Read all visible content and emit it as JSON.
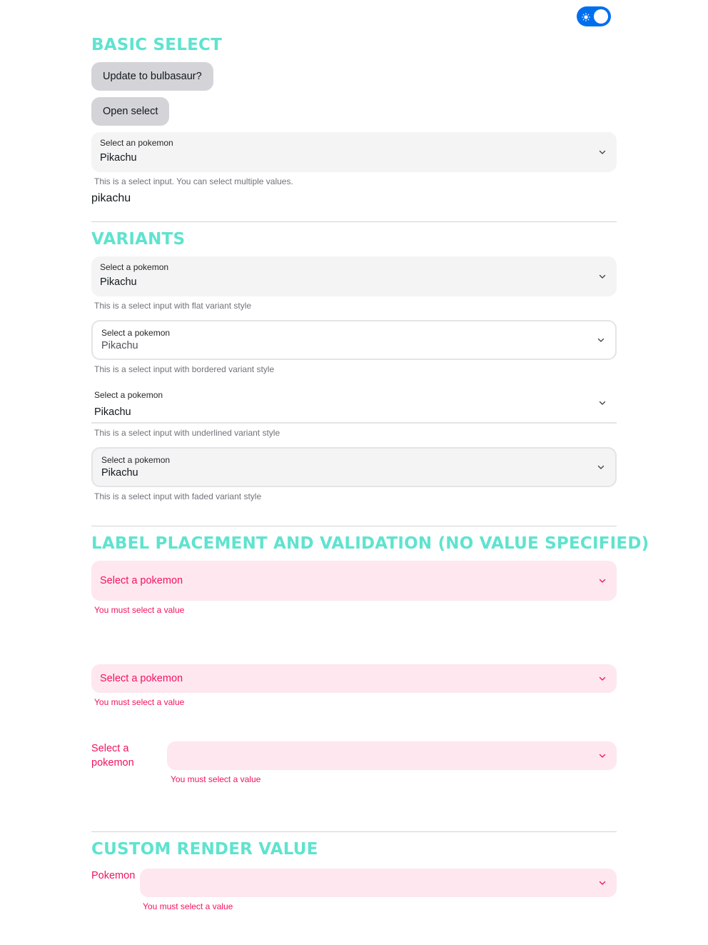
{
  "theme_toggle": {
    "state": "on",
    "icon": "sun-icon",
    "accent": "#006fee"
  },
  "colors": {
    "section_heading": "#5fe3cf",
    "danger": "#f31260",
    "danger_bg": "#fee7ef"
  },
  "basic": {
    "heading": "Basic Select",
    "update_button": "Update to bulbasaur?",
    "open_button": "Open select",
    "select_label": "Select an pokemon",
    "select_value": "Pikachu",
    "helper": "This is a select input. You can select multiple values.",
    "selected_key": "pikachu"
  },
  "variants": {
    "heading": "Variants",
    "flat": {
      "label": "Select a pokemon",
      "value": "Pikachu",
      "helper": "This is a select input with flat variant style"
    },
    "bordered": {
      "label": "Select a pokemon",
      "value": "Pikachu",
      "helper": "This is a select input with bordered variant style"
    },
    "underlined": {
      "label": "Select a pokemon",
      "value": "Pikachu",
      "helper": "This is a select input with underlined variant style"
    },
    "faded": {
      "label": "Select a pokemon",
      "value": "Pikachu",
      "helper": "This is a select input with faded variant style"
    }
  },
  "validation": {
    "heading": "Label placement and validation (no value specified)",
    "inside": {
      "placeholder": "Select a pokemon",
      "error": "You must select a value"
    },
    "outside": {
      "placeholder": "Select a pokemon",
      "error": "You must select a value"
    },
    "outside_left": {
      "label_line1": "Select a",
      "label_line2": "pokemon",
      "error": "You must select a value"
    }
  },
  "custom": {
    "heading": "Custom render value",
    "label": "Pokemon",
    "error": "You must select a value"
  }
}
